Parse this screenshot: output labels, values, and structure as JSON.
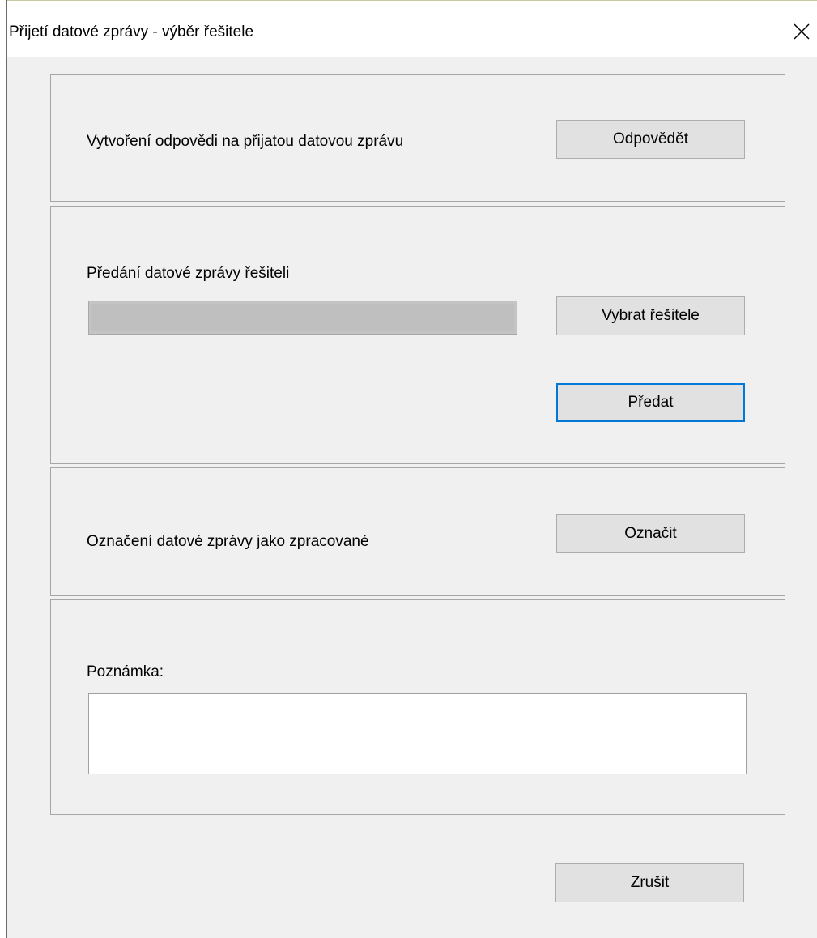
{
  "window": {
    "title": "Přijetí datové zprávy - výběr řešitele"
  },
  "reply_section": {
    "label": "Vytvoření odpovědi na přijatou datovou zprávu",
    "button_label": "Odpovědět"
  },
  "forward_section": {
    "label": "Předání datové zprávy řešiteli",
    "solver_value": "",
    "choose_button_label": "Vybrat řešitele",
    "forward_button_label": "Předat"
  },
  "mark_section": {
    "label": "Označení datové zprávy jako zpracované",
    "button_label": "Označit"
  },
  "note_section": {
    "label": "Poznámka:",
    "note_value": ""
  },
  "footer": {
    "cancel_label": "Zrušit"
  }
}
